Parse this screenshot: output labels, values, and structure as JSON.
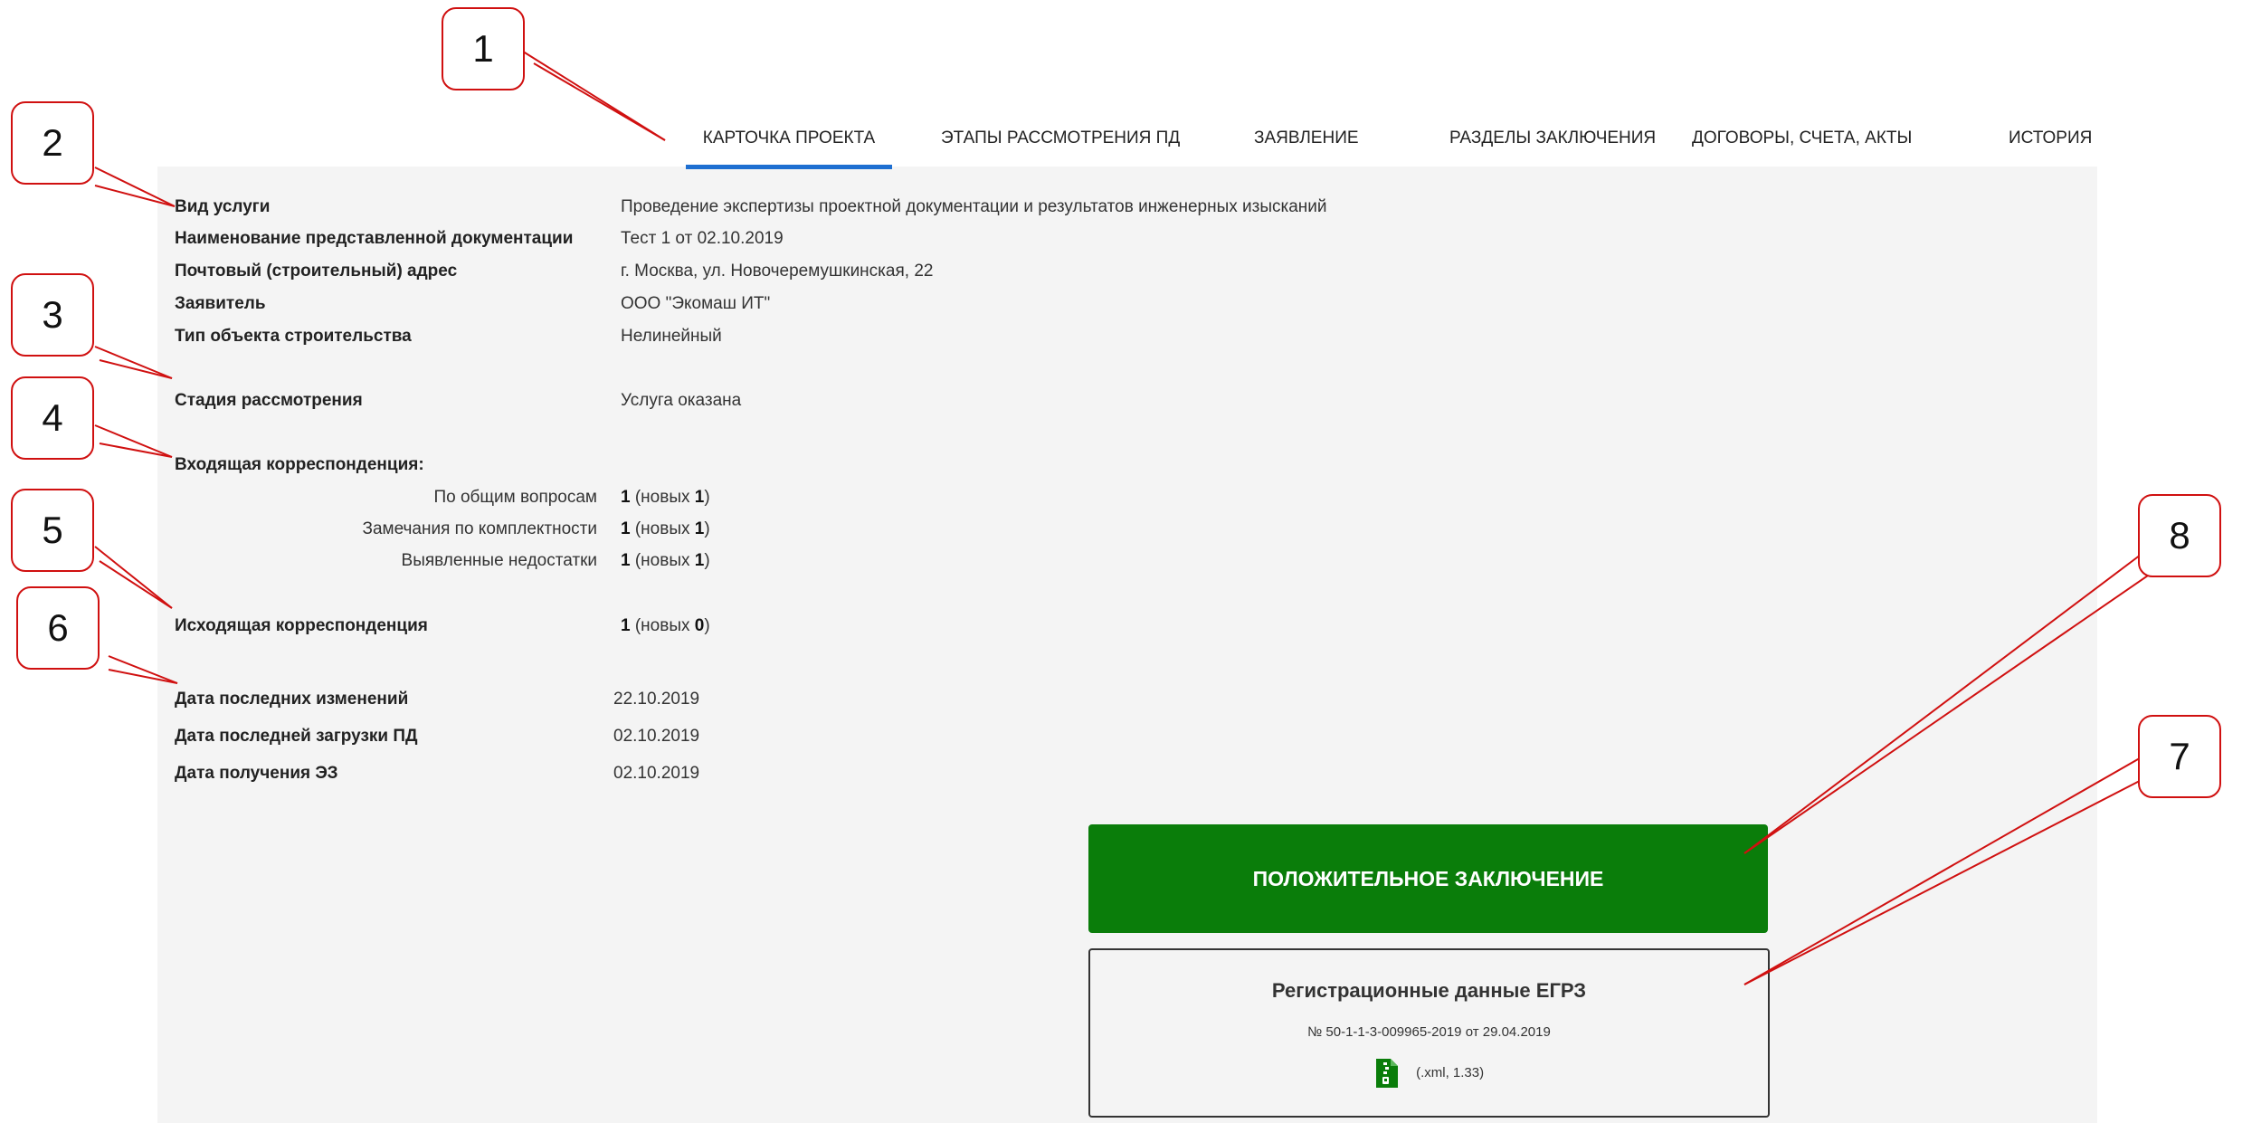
{
  "tabs": [
    {
      "label": "КАРТОЧКА ПРОЕКТА",
      "active": true
    },
    {
      "label": "ЭТАПЫ РАССМОТРЕНИЯ ПД"
    },
    {
      "label": "ЗАЯВЛЕНИЕ"
    },
    {
      "label": "РАЗДЕЛЫ ЗАКЛЮЧЕНИЯ"
    },
    {
      "label": "ДОГОВОРЫ, СЧЕТА, АКТЫ"
    },
    {
      "label": "ИСТОРИЯ"
    }
  ],
  "fields": {
    "service_type": {
      "label": "Вид услуги",
      "value": "Проведение экспертизы проектной документации и результатов инженерных изысканий"
    },
    "doc_name": {
      "label": "Наименование представленной документации",
      "value": "Тест 1 от 02.10.2019"
    },
    "address": {
      "label": "Почтовый (строительный) адрес",
      "value": "г. Москва, ул. Новочеремушкинская, 22"
    },
    "applicant": {
      "label": "Заявитель",
      "value": "ООО \"Экомаш ИТ\""
    },
    "object_type": {
      "label": "Тип объекта строительства",
      "value": "Нелинейный"
    },
    "stage": {
      "label": "Стадия рассмотрения",
      "value": "Услуга оказана"
    }
  },
  "incoming": {
    "label": "Входящая корреспонденция:",
    "rows": [
      {
        "label": "По общим вопросам",
        "count": "1",
        "new_prefix": "(новых",
        "new_count": "1",
        "suffix": ")"
      },
      {
        "label": "Замечания по комплектности",
        "count": "1",
        "new_prefix": "(новых",
        "new_count": "1",
        "suffix": ")"
      },
      {
        "label": "Выявленные недостатки",
        "count": "1",
        "new_prefix": "(новых",
        "new_count": "1",
        "suffix": ")"
      }
    ]
  },
  "outgoing": {
    "label": "Исходящая корреспонденция",
    "count": "1",
    "new_prefix": "(новых",
    "new_count": "0",
    "suffix": ")"
  },
  "dates": {
    "last_change": {
      "label": "Дата последних изменений",
      "value": "22.10.2019"
    },
    "last_upload": {
      "label": "Дата последней загрузки ПД",
      "value": "02.10.2019"
    },
    "ez_received": {
      "label": "Дата получения ЭЗ",
      "value": "02.10.2019"
    }
  },
  "conclusion_button": {
    "label": "ПОЛОЖИТЕЛЬНОЕ ЗАКЛЮЧЕНИЕ",
    "color": "#0a7d0a"
  },
  "egrz": {
    "title": "Регистрационные данные ЕГРЗ",
    "number": "№ 50-1-1-3-009965-2019 от 29.04.2019",
    "file_label": "(.xml, 1.33)",
    "file_icon": "zip-file-icon"
  },
  "callouts": [
    "1",
    "2",
    "3",
    "4",
    "5",
    "6",
    "7",
    "8"
  ],
  "colors": {
    "accent": "#1e6fd1",
    "callout_border": "#d01010"
  }
}
